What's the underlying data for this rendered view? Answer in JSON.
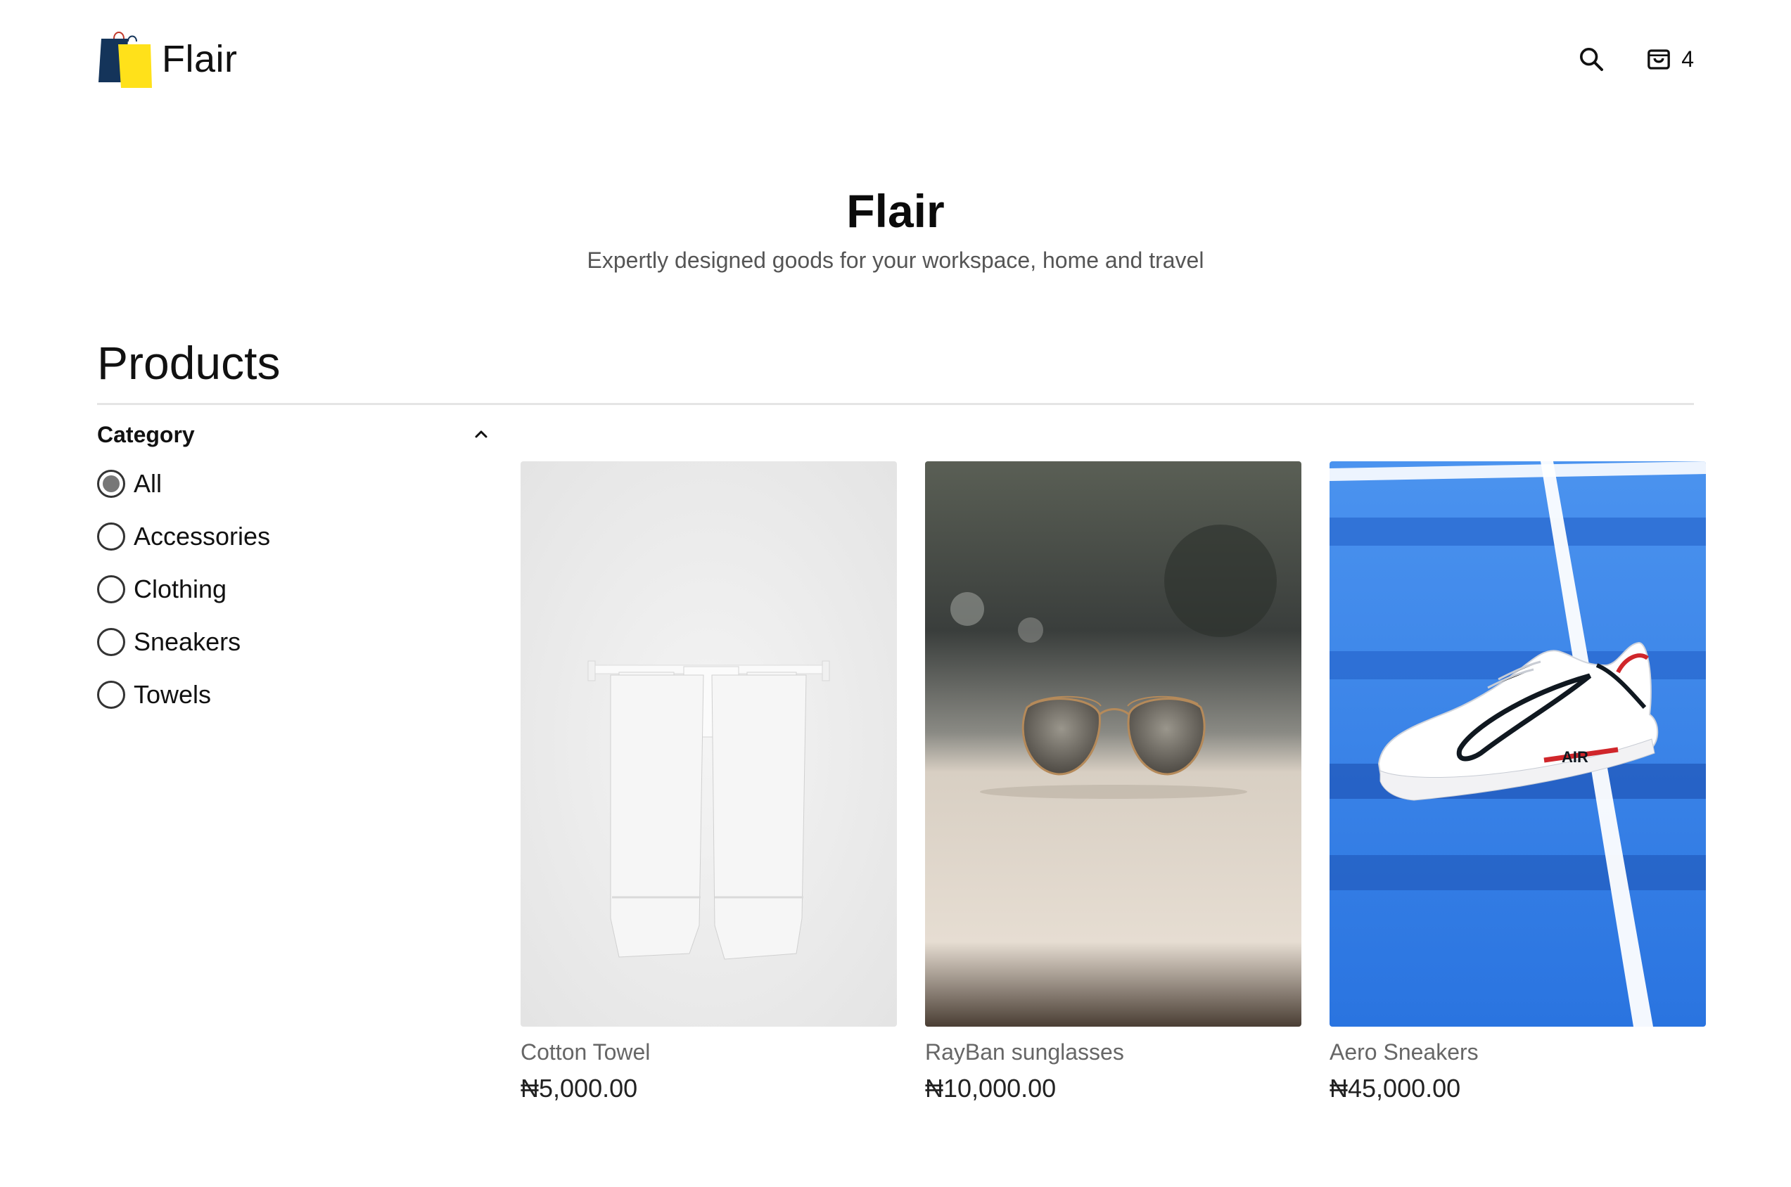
{
  "header": {
    "brand_name": "Flair",
    "search_icon": "search-icon",
    "cart_icon": "shopping-bag-icon",
    "cart_count": "4"
  },
  "hero": {
    "title": "Flair",
    "subtitle": "Expertly designed goods for your workspace, home and travel"
  },
  "products": {
    "heading": "Products"
  },
  "filters": {
    "title": "Category",
    "toggle_icon": "chevron-up-icon",
    "options": [
      {
        "label": "All",
        "checked": true
      },
      {
        "label": "Accessories",
        "checked": false
      },
      {
        "label": "Clothing",
        "checked": false
      },
      {
        "label": "Sneakers",
        "checked": false
      },
      {
        "label": "Towels",
        "checked": false
      }
    ]
  },
  "items": [
    {
      "name": "Cotton Towel",
      "price": "₦5,000.00",
      "image": "towels-on-rack"
    },
    {
      "name": "RayBan sunglasses",
      "price": "₦10,000.00",
      "image": "aviator-sunglasses"
    },
    {
      "name": "Aero Sneakers",
      "price": "₦45,000.00",
      "image": "white-sneaker-on-blue-court"
    }
  ],
  "colors": {
    "logo_navy": "#14345a",
    "logo_yellow": "#ffe11a",
    "text": "#111111",
    "muted": "#666666",
    "court_blue": "#2f7de6",
    "swoosh_red": "#d0262b"
  }
}
